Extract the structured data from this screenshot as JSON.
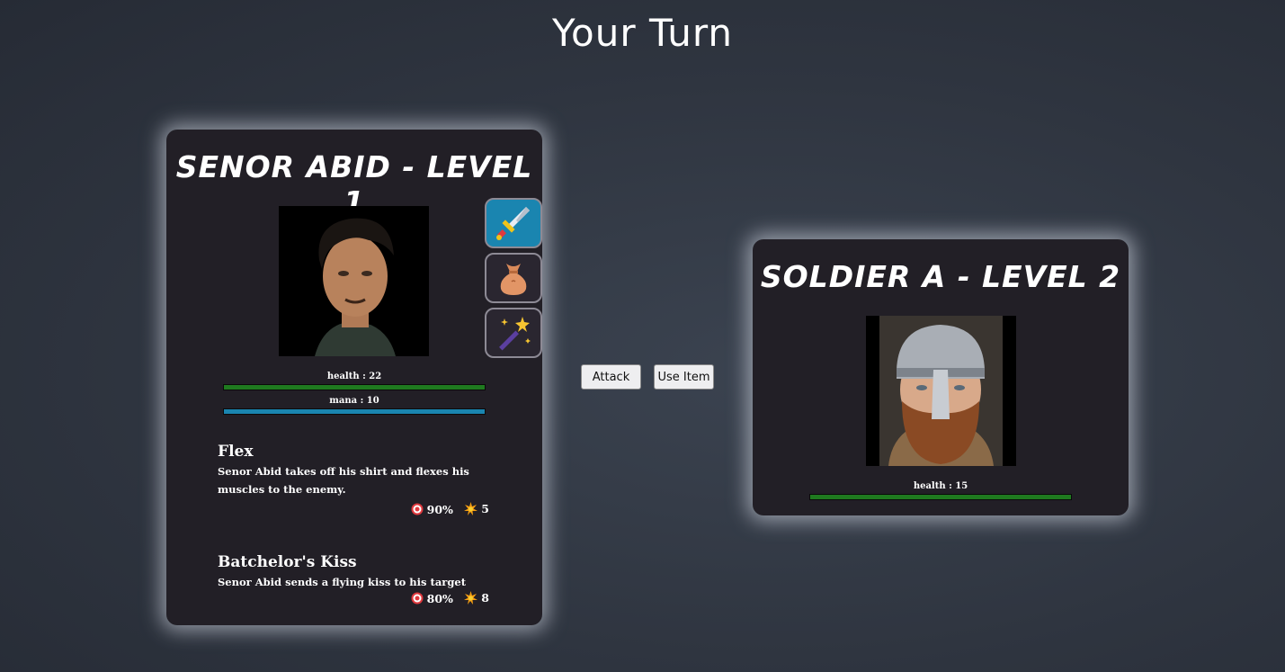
{
  "page_title": "Your Turn",
  "player": {
    "title": "Senor Abid - Level 1",
    "health_label": "health : 22",
    "mana_label": "mana : 10",
    "health_fraction": 1.0,
    "mana_fraction": 1.0,
    "health_color": "#1f7a1f",
    "mana_color": "#1a85b0",
    "action_icons": [
      "sword-icon",
      "money-bag-icon",
      "magic-wand-icon"
    ],
    "moves": [
      {
        "name": "Flex",
        "description": "Senor Abid takes off his shirt and flexes his muscles to the enemy.",
        "accuracy": "90%",
        "damage": "5"
      },
      {
        "name": "Batchelor's Kiss",
        "description": "Senor Abid sends a flying kiss to his target",
        "accuracy": "80%",
        "damage": "8"
      }
    ]
  },
  "enemy": {
    "title": "Soldier A - Level 2",
    "health_label": "health : 15",
    "health_fraction": 1.0,
    "health_color": "#1f7a1f"
  },
  "actions": {
    "attack_label": "Attack",
    "use_item_label": "Use Item"
  }
}
